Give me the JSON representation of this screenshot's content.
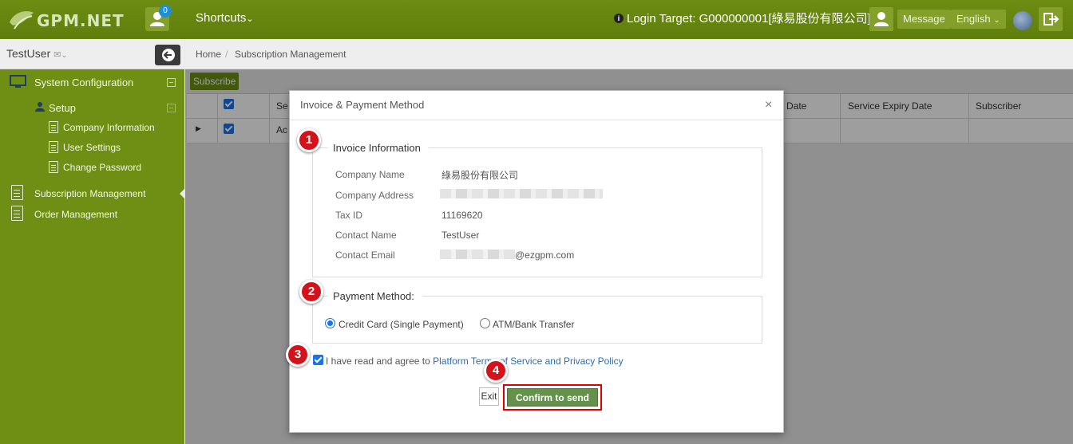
{
  "app": {
    "logo_text": "GPM.NET",
    "notification_count": "0",
    "shortcuts_label": "Shortcuts",
    "login_target": "Login Target: G000000001[綠易股份有限公司]",
    "message_label": "Message",
    "language_label": "English"
  },
  "sidebar": {
    "username": "TestUser",
    "items": [
      {
        "label": "System Configuration"
      },
      {
        "label": "Setup"
      },
      {
        "label": "Company Information"
      },
      {
        "label": "User Settings"
      },
      {
        "label": "Change Password"
      },
      {
        "label": "Subscription Management"
      },
      {
        "label": "Order Management"
      }
    ]
  },
  "breadcrumb": {
    "home": "Home",
    "separator": "/",
    "current": "Subscription Management"
  },
  "toolbar": {
    "subscribe_label": "Subscribe"
  },
  "grid": {
    "columns": {
      "service_partial": "Se",
      "date_partial": "Date",
      "expiry": "Service Expiry Date",
      "subscriber": "Subscriber"
    },
    "row": {
      "service_partial": "Ac"
    }
  },
  "modal": {
    "title": "Invoice & Payment Method",
    "close_symbol": "×",
    "invoice": {
      "legend": "Invoice Information",
      "fields": [
        {
          "label": "Company Name",
          "value": "綠易股份有限公司"
        },
        {
          "label": "Company Address",
          "value": ""
        },
        {
          "label": "Tax ID",
          "value": "11169620"
        },
        {
          "label": "Contact Name",
          "value": "TestUser"
        },
        {
          "label": "Contact Email",
          "value": "@ezgpm.com"
        }
      ]
    },
    "payment": {
      "legend": "Payment Method:",
      "options": [
        {
          "label": "Credit Card (Single Payment)",
          "selected": true
        },
        {
          "label": "ATM/Bank Transfer",
          "selected": false
        }
      ]
    },
    "agreement": {
      "prefix": "I have read and agree to ",
      "link": "Platform Terms of Service and Privacy Policy",
      "checked": true
    },
    "buttons": {
      "exit": "Exit",
      "confirm": "Confirm to send out"
    }
  },
  "steps": [
    "1",
    "2",
    "3",
    "4"
  ],
  "colors": {
    "header_green": "#6c8c12",
    "sidebar_green": "#6f8f14",
    "confirm_green": "#64924a",
    "step_red": "#d4121c",
    "link_blue": "#2a6fb0"
  }
}
